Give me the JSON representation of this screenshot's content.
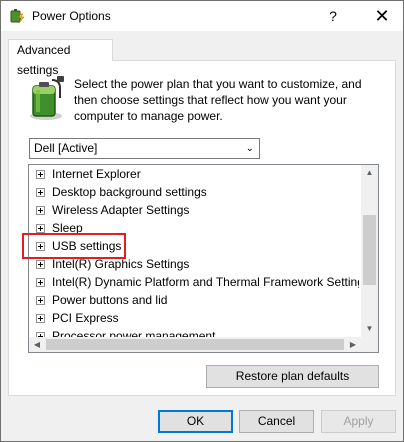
{
  "window": {
    "title": "Power Options",
    "help_glyph": "?",
    "close_glyph": "✕"
  },
  "tab": {
    "label": "Advanced settings"
  },
  "description": "Select the power plan that you want to customize, and then choose settings that reflect how you want your computer to manage power.",
  "plan_select": {
    "value": "Dell [Active]",
    "chevron": "⌄"
  },
  "tree": {
    "items": [
      {
        "label": "Internet Explorer"
      },
      {
        "label": "Desktop background settings"
      },
      {
        "label": "Wireless Adapter Settings"
      },
      {
        "label": "Sleep"
      },
      {
        "label": "USB settings",
        "highlighted": true
      },
      {
        "label": "Intel(R) Graphics Settings"
      },
      {
        "label": "Intel(R) Dynamic Platform and Thermal Framework Settings"
      },
      {
        "label": "Power buttons and lid"
      },
      {
        "label": "PCI Express"
      },
      {
        "label": "Processor power management"
      }
    ]
  },
  "scroll_glyphs": {
    "up": "▲",
    "down": "▼",
    "left": "◀",
    "right": "▶"
  },
  "buttons": {
    "restore": "Restore plan defaults",
    "ok": "OK",
    "cancel": "Cancel",
    "apply": "Apply"
  },
  "colors": {
    "highlight_box": "#e02020",
    "default_button_border": "#0078d7",
    "disabled_text": "#a0a0a0"
  }
}
